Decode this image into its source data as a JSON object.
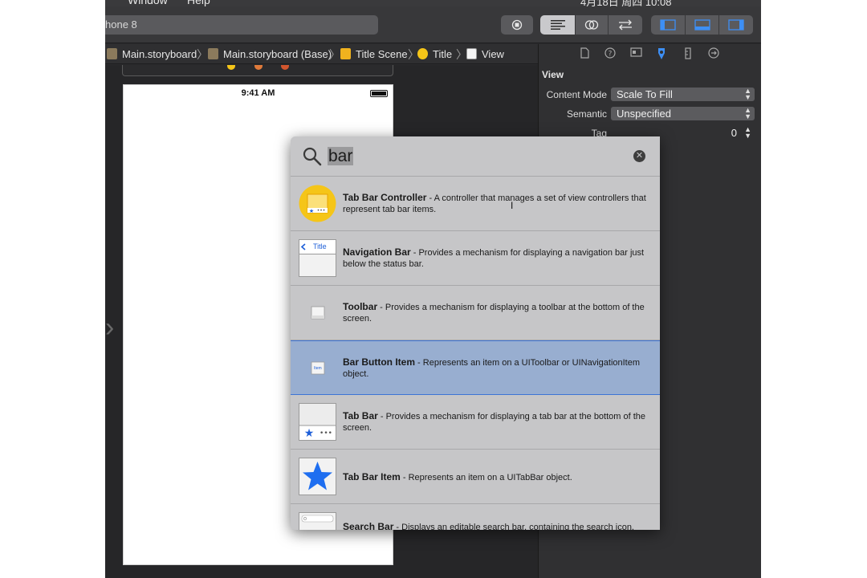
{
  "menubar": {
    "items": [
      "Window",
      "Help"
    ],
    "clock": "4月18日 周四 10:08"
  },
  "toolbar": {
    "scheme_label": "hone 8"
  },
  "jumpbar": {
    "crumbs": [
      "Main.storyboard",
      "Main.storyboard (Base)",
      "Title Scene",
      "Title",
      "View"
    ]
  },
  "canvas": {
    "status_time": "9:41 AM"
  },
  "inspector": {
    "section_title": "View",
    "rows": [
      {
        "label": "Content Mode",
        "value": "Scale To Fill"
      },
      {
        "label": "Semantic",
        "value": "Unspecified"
      },
      {
        "label": "Tag",
        "value": "0"
      }
    ]
  },
  "library": {
    "query": "bar",
    "items": [
      {
        "name": "Tab Bar Controller",
        "desc": " - A controller that manages a set of view controllers that represent tab bar items.",
        "selected": false
      },
      {
        "name": "Navigation Bar",
        "desc": " - Provides a mechanism for displaying a navigation bar just below the status bar.",
        "selected": false,
        "thumb_label": "Title"
      },
      {
        "name": "Toolbar",
        "desc": " - Provides a mechanism for displaying a toolbar at the bottom of the screen.",
        "selected": false
      },
      {
        "name": "Bar Button Item",
        "desc": " - Represents an item on a UIToolbar or UINavigationItem object.",
        "selected": true,
        "thumb_label": "Item"
      },
      {
        "name": "Tab Bar",
        "desc": " - Provides a mechanism for displaying a tab bar at the bottom of the screen.",
        "selected": false
      },
      {
        "name": "Tab Bar Item",
        "desc": " - Represents an item on a UITabBar object.",
        "selected": false
      },
      {
        "name": "Search Bar",
        "desc": " - Displays an editable search bar, containing the search icon,",
        "selected": false
      }
    ]
  },
  "colors": {
    "accent": "#3d8ff5",
    "selection": "#98aed0",
    "controller_yellow": "#f5c518"
  }
}
